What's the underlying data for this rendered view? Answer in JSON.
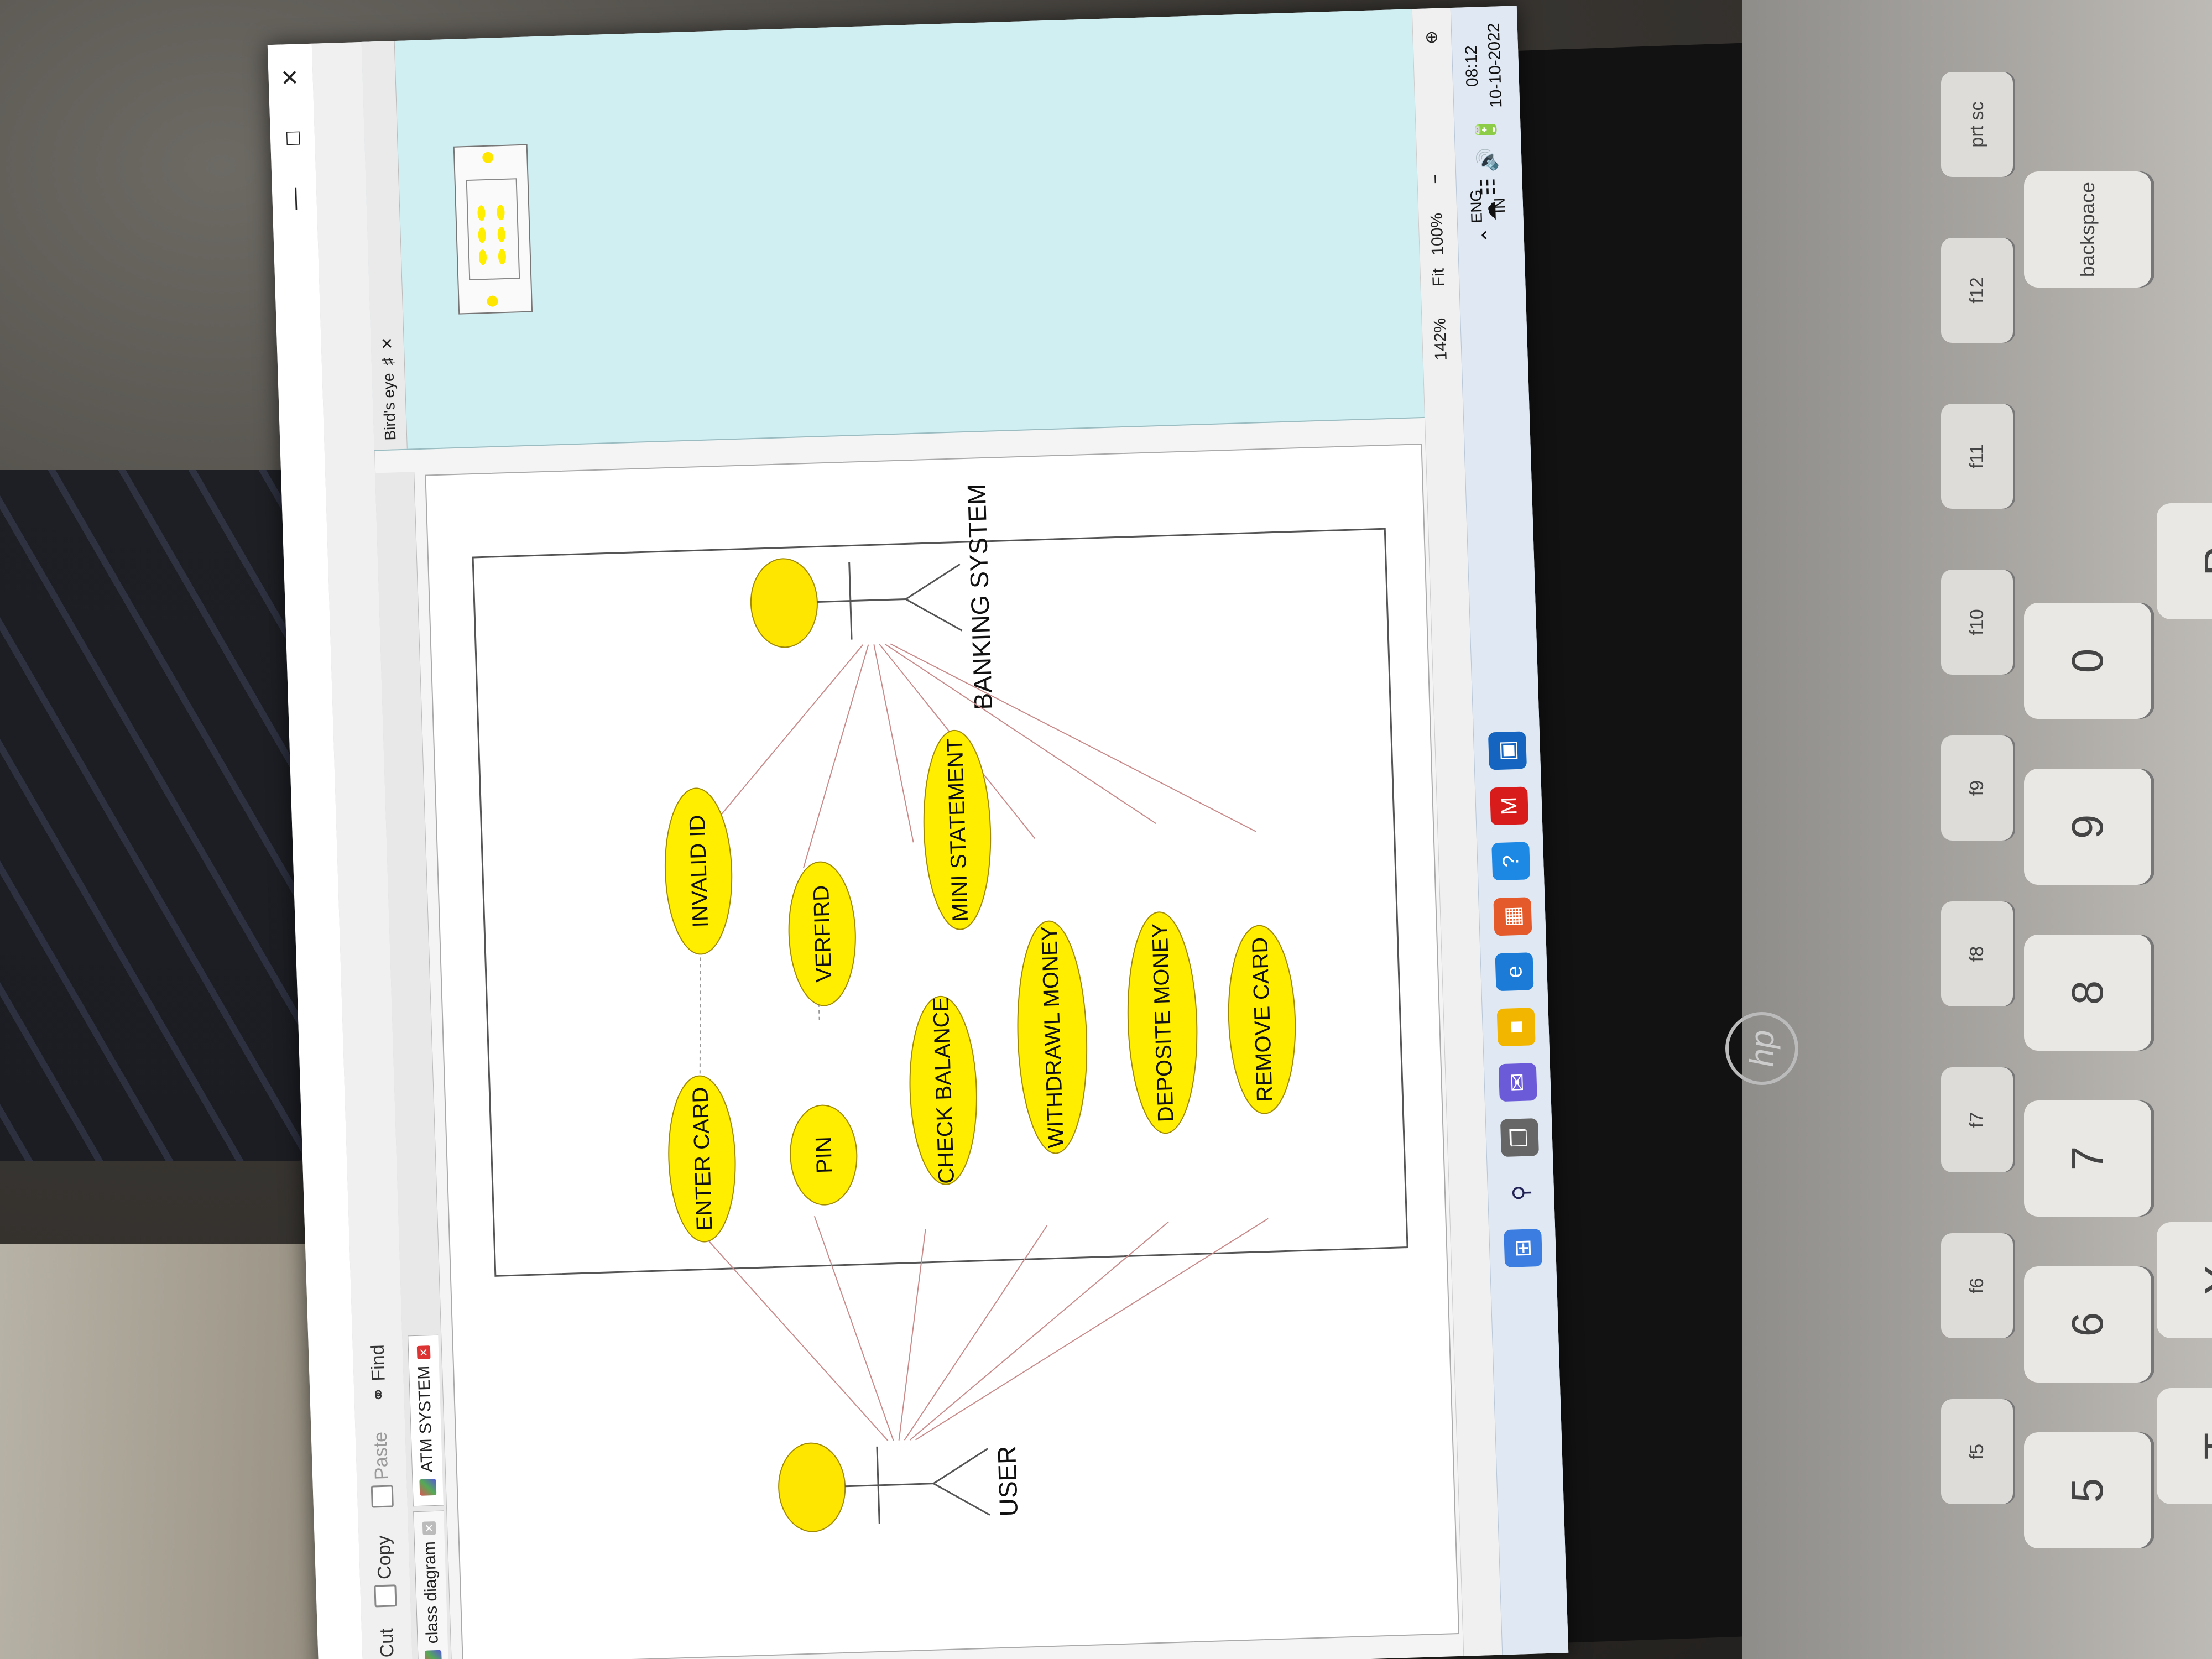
{
  "toolbar": {
    "cut_label": "Cut",
    "copy_label": "Copy",
    "paste_label": "Paste",
    "find_label": "Find"
  },
  "tabs": [
    {
      "label": "class diagram"
    },
    {
      "label": "ATM SYSTEM"
    }
  ],
  "birds_eye": {
    "title": "Bird's eye"
  },
  "diagram": {
    "actors": {
      "user": "USER",
      "banking": "BANKING SYSTEM"
    },
    "use_cases": {
      "enter_card": "ENTER CARD",
      "invalid_id": "INVALID ID",
      "pin": "PIN",
      "verified": "VERFIRD",
      "check_balance": "CHECK BALANCE",
      "mini_statement": "MINI STATEMENT",
      "withdraw": "WITHDRAWL MONEY",
      "deposit": "DEPOSITE MONEY",
      "remove_card": "REMOVE CARD"
    },
    "colors": {
      "use_case_fill": "#ffee00",
      "use_case_stroke": "#a08a00",
      "association_line": "#c98a8a",
      "actor_head": "#ffe600"
    }
  },
  "statusbar": {
    "zoom_level": "142%",
    "fit_label": "Fit",
    "zoom_100": "100%"
  },
  "taskbar": {
    "language_top": "ENG",
    "language_bottom": "IN",
    "time": "08:12",
    "date": "10-10-2022"
  },
  "keyboard": {
    "keys": [
      "5",
      "6",
      "7",
      "8",
      "9",
      "0",
      "backspace",
      "T",
      "Y",
      "P"
    ],
    "fkeys": [
      "f5",
      "f6",
      "f7",
      "f8",
      "f9",
      "f10",
      "f11",
      "f12",
      "prt sc"
    ]
  }
}
